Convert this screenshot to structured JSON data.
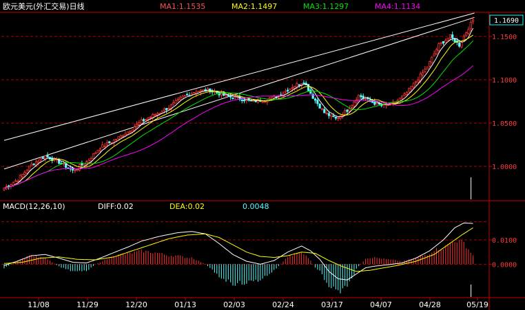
{
  "header": {
    "title": "欧元美元(外汇交易)日线",
    "ma1": "MA1:1.1535",
    "ma2": "MA2:1.1497",
    "ma3": "MA3:1.1297",
    "ma4": "MA4:1.1134"
  },
  "macd_header": {
    "name": "MACD(12,26,10)",
    "diff": "DIFF:0.02",
    "dea": "DEA:0.02",
    "macd": "0.0048"
  },
  "colors": {
    "up": "#ff3232",
    "down": "#54fcfc",
    "ma1": "#ffffff",
    "ma2": "#ffff00",
    "ma3": "#00e600",
    "ma4": "#ff00ff",
    "grid": "#b40000",
    "axis": "#c80000",
    "title": "#ffffff",
    "ma1_text": "#ff5050",
    "tick_text": "#ff3c3c",
    "date_text": "#ffffff",
    "last_price_box": "#00ffff"
  },
  "chart_data": [
    {
      "type": "candlestick",
      "ylim": [
        0.962,
        1.177
      ],
      "y_ticks": [
        "1.1500",
        "1.1000",
        "1.0500",
        "1.0000"
      ],
      "y_tick_values": [
        1.15,
        1.1,
        1.05,
        1.0
      ],
      "last_price": "1.1690",
      "last_price_value": 1.169,
      "x_labels": [
        "11/08",
        "11/29",
        "12/20",
        "01/13",
        "02/03",
        "02/24",
        "03/17",
        "04/07",
        "04/28",
        "05/19"
      ],
      "close_anchors": [
        [
          0,
          0.975
        ],
        [
          6,
          0.985
        ],
        [
          12,
          1.002
        ],
        [
          18,
          1.012
        ],
        [
          24,
          1.005
        ],
        [
          30,
          0.995
        ],
        [
          36,
          1.005
        ],
        [
          42,
          1.022
        ],
        [
          48,
          1.03
        ],
        [
          54,
          1.04
        ],
        [
          60,
          1.052
        ],
        [
          66,
          1.06
        ],
        [
          72,
          1.068
        ],
        [
          78,
          1.08
        ],
        [
          84,
          1.087
        ],
        [
          90,
          1.088
        ],
        [
          96,
          1.082
        ],
        [
          102,
          1.079
        ],
        [
          108,
          1.075
        ],
        [
          114,
          1.077
        ],
        [
          120,
          1.082
        ],
        [
          126,
          1.092
        ],
        [
          131,
          1.098
        ],
        [
          135,
          1.08
        ],
        [
          140,
          1.062
        ],
        [
          145,
          1.055
        ],
        [
          150,
          1.065
        ],
        [
          155,
          1.082
        ],
        [
          160,
          1.075
        ],
        [
          165,
          1.07
        ],
        [
          170,
          1.072
        ],
        [
          175,
          1.082
        ],
        [
          180,
          1.098
        ],
        [
          185,
          1.115
        ],
        [
          190,
          1.14
        ],
        [
          195,
          1.15
        ],
        [
          199,
          1.14
        ],
        [
          203,
          1.16
        ],
        [
          205,
          1.169
        ]
      ],
      "trend_lines": [
        [
          [
            0,
            1.03
          ],
          [
            205,
            1.177
          ]
        ],
        [
          [
            0,
            0.997
          ],
          [
            205,
            1.172
          ]
        ]
      ]
    },
    {
      "type": "macd",
      "ylim": [
        -0.0135,
        0.0205
      ],
      "y_ticks": [
        "0.0100",
        "0.0000"
      ],
      "y_tick_values": [
        0.01,
        0.0
      ],
      "diff_anchors": [
        [
          0,
          -0.0005
        ],
        [
          5,
          0.001
        ],
        [
          12,
          0.0035
        ],
        [
          18,
          0.004
        ],
        [
          24,
          0.0025
        ],
        [
          30,
          0.0008
        ],
        [
          36,
          0.0005
        ],
        [
          42,
          0.0025
        ],
        [
          48,
          0.0048
        ],
        [
          54,
          0.007
        ],
        [
          60,
          0.0095
        ],
        [
          68,
          0.0115
        ],
        [
          76,
          0.013
        ],
        [
          82,
          0.0135
        ],
        [
          88,
          0.0125
        ],
        [
          94,
          0.0085
        ],
        [
          100,
          0.004
        ],
        [
          106,
          0.0012
        ],
        [
          112,
          0.0
        ],
        [
          118,
          0.0015
        ],
        [
          124,
          0.005
        ],
        [
          130,
          0.0075
        ],
        [
          134,
          0.0055
        ],
        [
          138,
          0.002
        ],
        [
          142,
          -0.003
        ],
        [
          146,
          -0.006
        ],
        [
          150,
          -0.0065
        ],
        [
          154,
          -0.004
        ],
        [
          158,
          -0.0015
        ],
        [
          162,
          -0.0008
        ],
        [
          168,
          -0.0002
        ],
        [
          174,
          0.0005
        ],
        [
          180,
          0.0025
        ],
        [
          186,
          0.0055
        ],
        [
          192,
          0.01
        ],
        [
          197,
          0.015
        ],
        [
          201,
          0.017
        ],
        [
          205,
          0.0168
        ]
      ],
      "dea_anchors": [
        [
          0,
          0.0003
        ],
        [
          8,
          0.0008
        ],
        [
          16,
          0.0025
        ],
        [
          24,
          0.003
        ],
        [
          32,
          0.002
        ],
        [
          40,
          0.0018
        ],
        [
          48,
          0.003
        ],
        [
          56,
          0.0055
        ],
        [
          64,
          0.008
        ],
        [
          72,
          0.0105
        ],
        [
          80,
          0.012
        ],
        [
          88,
          0.0125
        ],
        [
          94,
          0.011
        ],
        [
          100,
          0.008
        ],
        [
          106,
          0.005
        ],
        [
          112,
          0.0032
        ],
        [
          118,
          0.0028
        ],
        [
          124,
          0.0035
        ],
        [
          130,
          0.005
        ],
        [
          136,
          0.0045
        ],
        [
          142,
          0.0015
        ],
        [
          148,
          -0.001
        ],
        [
          154,
          -0.003
        ],
        [
          160,
          -0.0025
        ],
        [
          166,
          -0.0015
        ],
        [
          172,
          -0.0005
        ],
        [
          180,
          0.0012
        ],
        [
          188,
          0.004
        ],
        [
          194,
          0.008
        ],
        [
          200,
          0.012
        ],
        [
          205,
          0.015
        ]
      ]
    }
  ]
}
